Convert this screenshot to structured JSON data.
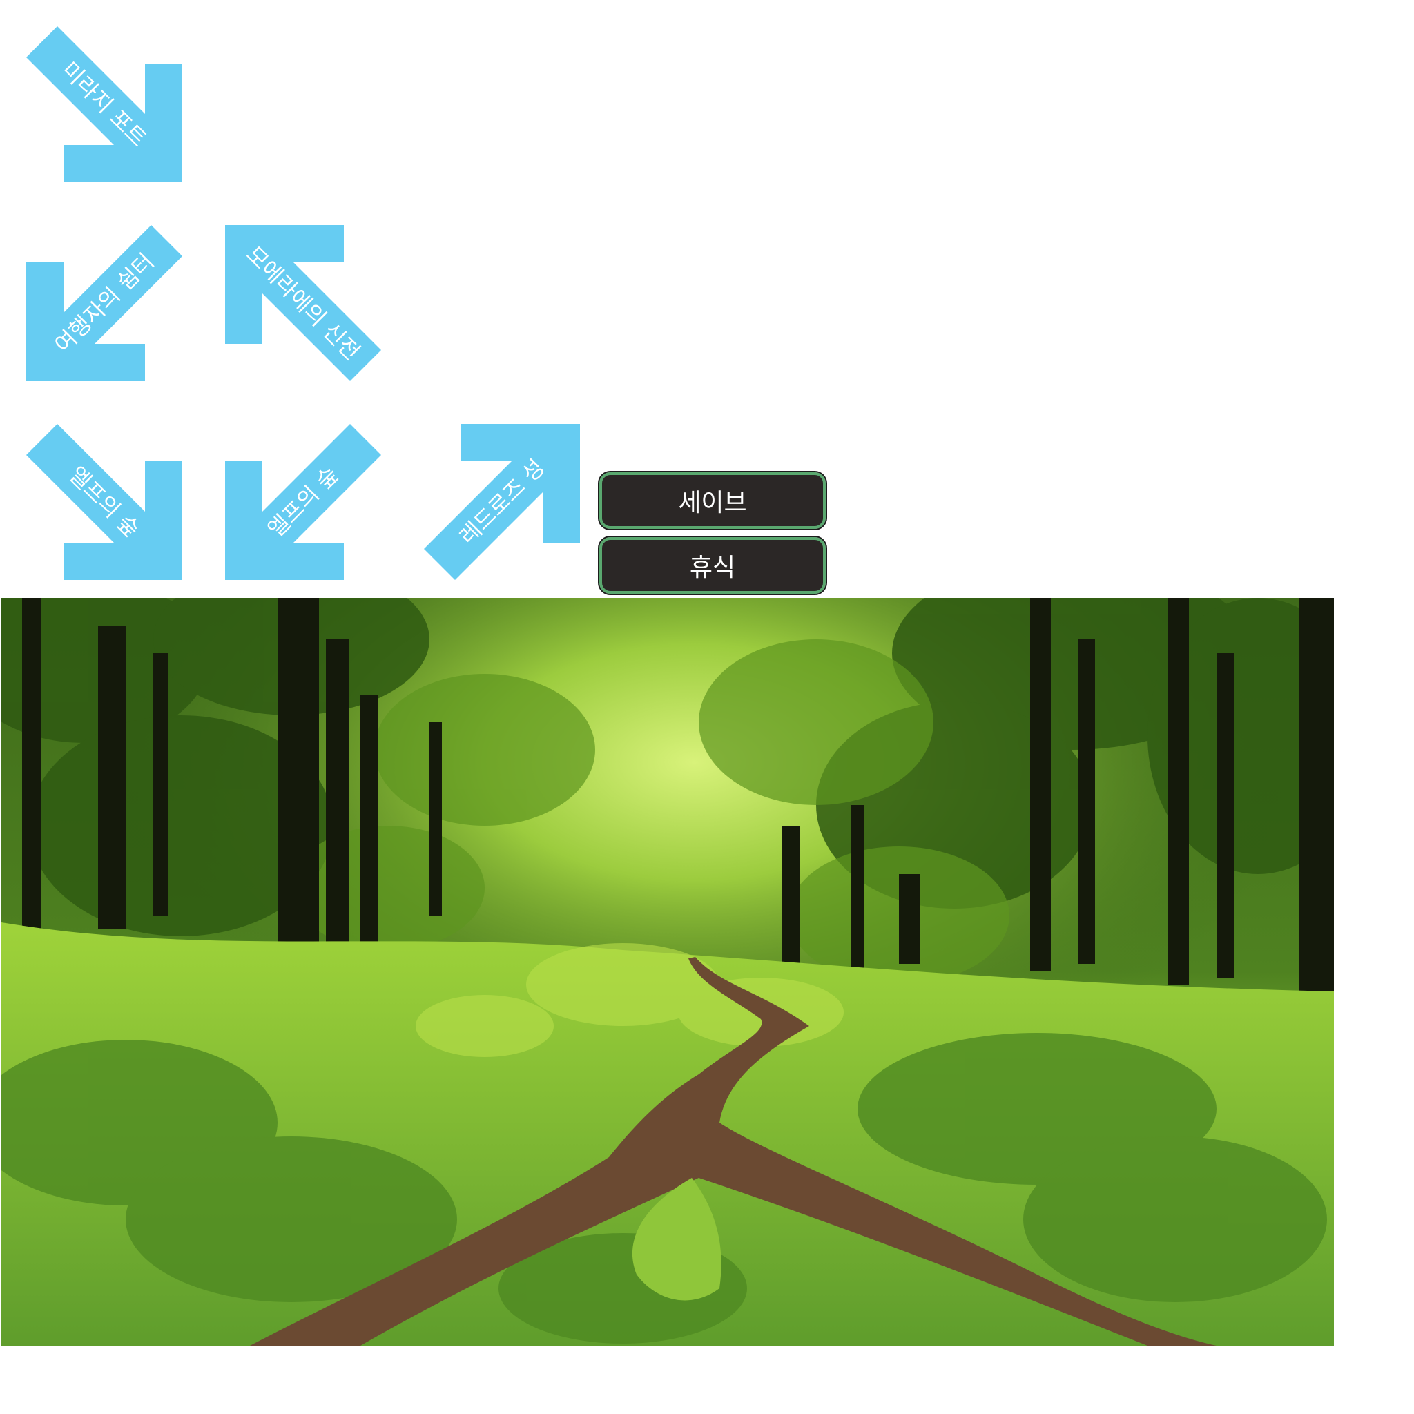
{
  "arrow_color": "#66ccf2",
  "map_arrows": [
    {
      "label": "미라지 포트",
      "direction": "down-right"
    },
    {
      "label": "여행자의 쉼터",
      "direction": "down-left"
    },
    {
      "label": "모에라에의 신전",
      "direction": "up-left"
    },
    {
      "label": "엘프의 숲",
      "direction": "down-right"
    },
    {
      "label": "엘프의 숲",
      "direction": "down-left"
    },
    {
      "label": "레드로즈 성",
      "direction": "up-right"
    }
  ],
  "menu": {
    "save_label": "세이브",
    "rest_label": "휴식"
  },
  "scene": {
    "description_colors": {
      "foliage_light": "#a7d63d",
      "foliage_dark": "#2f5a12",
      "trunk": "#14190b",
      "path": "#6b4a32"
    }
  }
}
